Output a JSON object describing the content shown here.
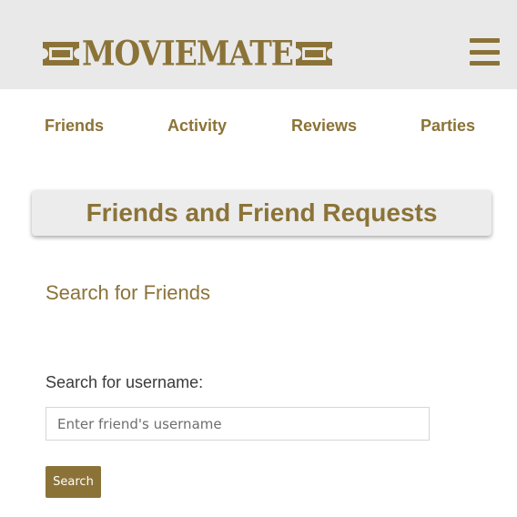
{
  "brand": {
    "name": "MOVIEMATE",
    "accent_color": "#8b7338",
    "left_icon": "ticket-icon",
    "right_icon": "ticket-icon"
  },
  "header": {
    "menu_icon": "hamburger-menu-icon"
  },
  "nav": {
    "items": [
      {
        "label": "Friends"
      },
      {
        "label": "Activity"
      },
      {
        "label": "Reviews"
      },
      {
        "label": "Parties"
      }
    ]
  },
  "main": {
    "title": "Friends and Friend Requests",
    "section_title": "Search for Friends",
    "search": {
      "label": "Search for username:",
      "placeholder": "Enter friend's username",
      "value": "",
      "button_label": "Search"
    }
  }
}
